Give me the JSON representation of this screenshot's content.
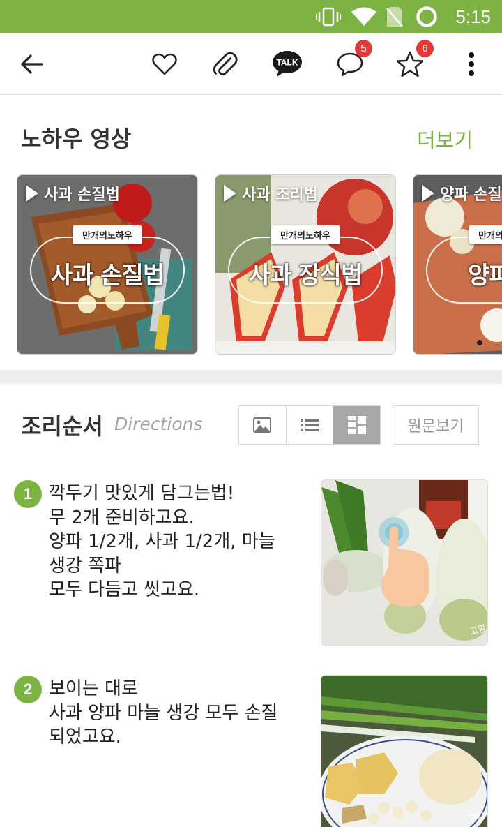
{
  "status_bar": {
    "time": "5:15",
    "bg_color": "#7cb342",
    "icons": [
      "vibrate-icon",
      "wifi-icon",
      "no-sim-icon",
      "battery-ring-icon"
    ]
  },
  "toolbar": {
    "back_icon": "arrow-left-icon",
    "like_icon": "heart-outline-icon",
    "attach_icon": "paperclip-icon",
    "talk_label": "TALK",
    "comment_count": "5",
    "star_count": "6",
    "more_icon": "more-vertical-icon"
  },
  "knowhow": {
    "title": "노하우 영상",
    "more_label": "더보기",
    "videos": [
      {
        "label": "사과 손질법",
        "badge": "만개의노하우",
        "title": "사과 손질법"
      },
      {
        "label": "사과 조리법",
        "badge": "만개의노하우",
        "title": "사과 장식법"
      },
      {
        "label": "양파 손질",
        "badge": "만개의노하우",
        "title": "양파 손"
      }
    ]
  },
  "directions": {
    "title": "조리순서",
    "subtitle": "Directions",
    "view_icons": [
      "image-view-icon",
      "list-view-icon",
      "grid-view-icon"
    ],
    "active_view": "grid-view-icon",
    "original_label": "원문보기",
    "steps": [
      {
        "num": "1",
        "lines": [
          "깍두기 맛있게 담그는법!",
          "무 2개 준비하고요.",
          "양파 1/2개, 사과 1/2개, 마늘",
          "생강 쪽파",
          "모두 다듬고 씻고요."
        ]
      },
      {
        "num": "2",
        "lines": [
          "보이는 대로",
          "사과 양파 마늘 생강 모두 손질",
          "되었고요."
        ]
      }
    ]
  },
  "colors": {
    "accent_green": "#7cb342",
    "badge_red": "#e53935",
    "divider_gray": "#eeeeee"
  }
}
